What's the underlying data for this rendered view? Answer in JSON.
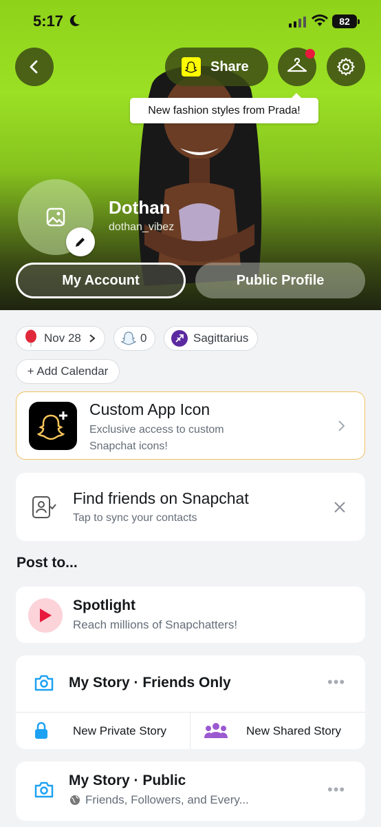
{
  "status_bar": {
    "time": "5:17",
    "battery": "82"
  },
  "header": {
    "share_label": "Share",
    "tooltip": "New fashion styles from Prada!",
    "name": "Dothan",
    "username": "dothan_vibez",
    "my_account_label": "My Account",
    "public_profile_label": "Public Profile",
    "accent_color": "#9be025"
  },
  "chips": {
    "birthday": "Nov 28",
    "snapscore": "0",
    "zodiac": "Sagittarius",
    "add_calendar": "+ Add Calendar"
  },
  "custom_icon_card": {
    "title": "Custom App Icon",
    "subtitle_line1": "Exclusive access to custom",
    "subtitle_line2": "Snapchat icons!"
  },
  "find_friends_card": {
    "title": "Find friends on Snapchat",
    "subtitle": "Tap to sync your contacts"
  },
  "post_section": {
    "title": "Post to...",
    "spotlight_title": "Spotlight",
    "spotlight_sub": "Reach millions of Snapchatters!",
    "my_story_friends": "My Story · Friends Only",
    "new_private_story": "New Private Story",
    "new_shared_story": "New Shared Story",
    "my_story_public": "My Story · Public",
    "public_sub": "Friends, Followers, and Every..."
  }
}
